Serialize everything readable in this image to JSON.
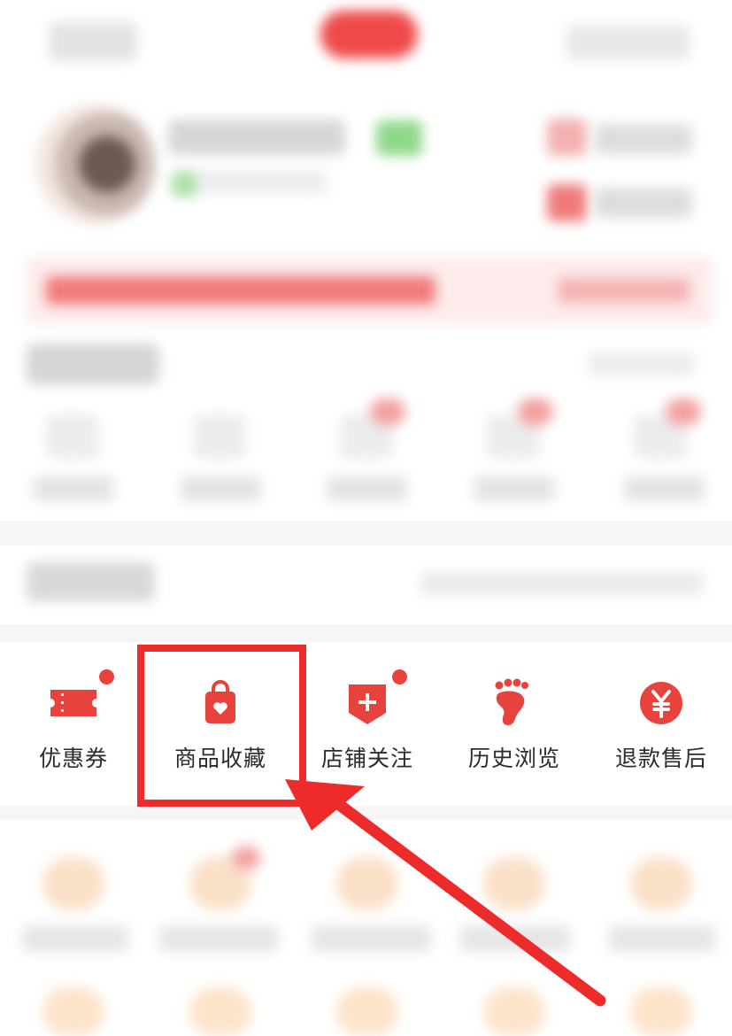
{
  "tools": [
    {
      "id": "coupon",
      "label": "优惠券",
      "icon": "ticket-icon",
      "badge": true
    },
    {
      "id": "favorites",
      "label": "商品收藏",
      "icon": "bag-heart-icon",
      "badge": false
    },
    {
      "id": "follow",
      "label": "店铺关注",
      "icon": "shop-plus-icon",
      "badge": true
    },
    {
      "id": "history",
      "label": "历史浏览",
      "icon": "footprint-icon",
      "badge": false
    },
    {
      "id": "refund",
      "label": "退款售后",
      "icon": "yuan-icon",
      "badge": false
    }
  ],
  "annotation": {
    "highlighted_item": "商品收藏",
    "color": "#ee2b2b"
  },
  "colors": {
    "accent": "#e8423d",
    "text": "#2b2b2b"
  }
}
